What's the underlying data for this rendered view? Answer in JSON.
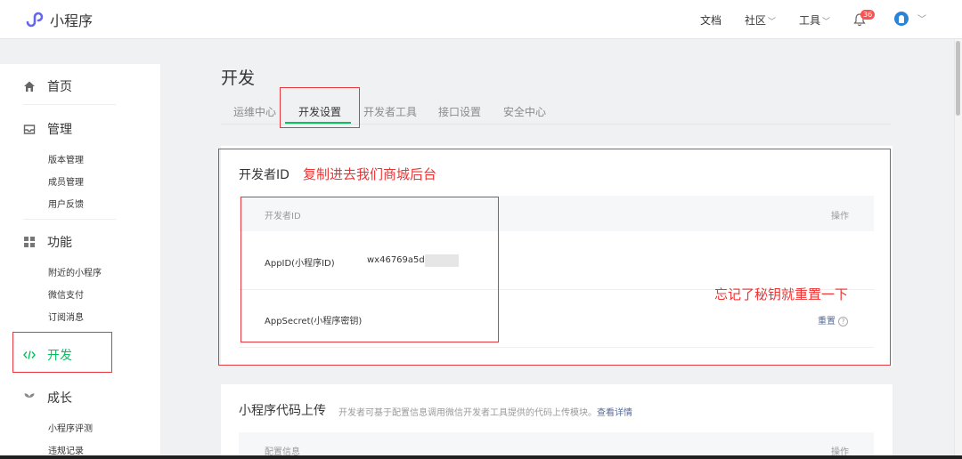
{
  "app": {
    "title": "小程序"
  },
  "topnav": {
    "docs": "文档",
    "community": "社区",
    "tools": "工具",
    "notification_count": "36"
  },
  "sidebar": {
    "home": "首页",
    "manage": {
      "label": "管理",
      "items": [
        "版本管理",
        "成员管理",
        "用户反馈"
      ]
    },
    "features": {
      "label": "功能",
      "items": [
        "附近的小程序",
        "微信支付",
        "订阅消息"
      ]
    },
    "develop": "开发",
    "growth": {
      "label": "成长",
      "items": [
        "小程序评测",
        "违规记录"
      ]
    }
  },
  "main": {
    "title": "开发",
    "tabs": [
      "运维中心",
      "开发设置",
      "开发者工具",
      "接口设置",
      "安全中心"
    ],
    "active_tab": "开发设置",
    "developer_id_card": {
      "title": "开发者ID",
      "table_headers": {
        "left": "开发者ID",
        "right": "操作"
      },
      "rows": [
        {
          "label": "AppID(小程序ID)",
          "value": "wx46769a5dc"
        },
        {
          "label": "AppSecret(小程序密钥)",
          "action": "重置"
        }
      ]
    },
    "upload_card": {
      "title": "小程序代码上传",
      "description": "开发者可基于配置信息调用微信开发者工具提供的代码上传模块。",
      "details_link": "查看详情",
      "table_headers": {
        "left": "配置信息",
        "right": "操作"
      }
    }
  },
  "annotations": {
    "copy_note": "复制进去我们商城后台",
    "reset_note": "忘记了秘钥就重置一下"
  },
  "colors": {
    "accent_green": "#07c160",
    "annotation_red": "#e8383d",
    "link_blue": "#576b95",
    "logo_purple": "#6467f0"
  }
}
